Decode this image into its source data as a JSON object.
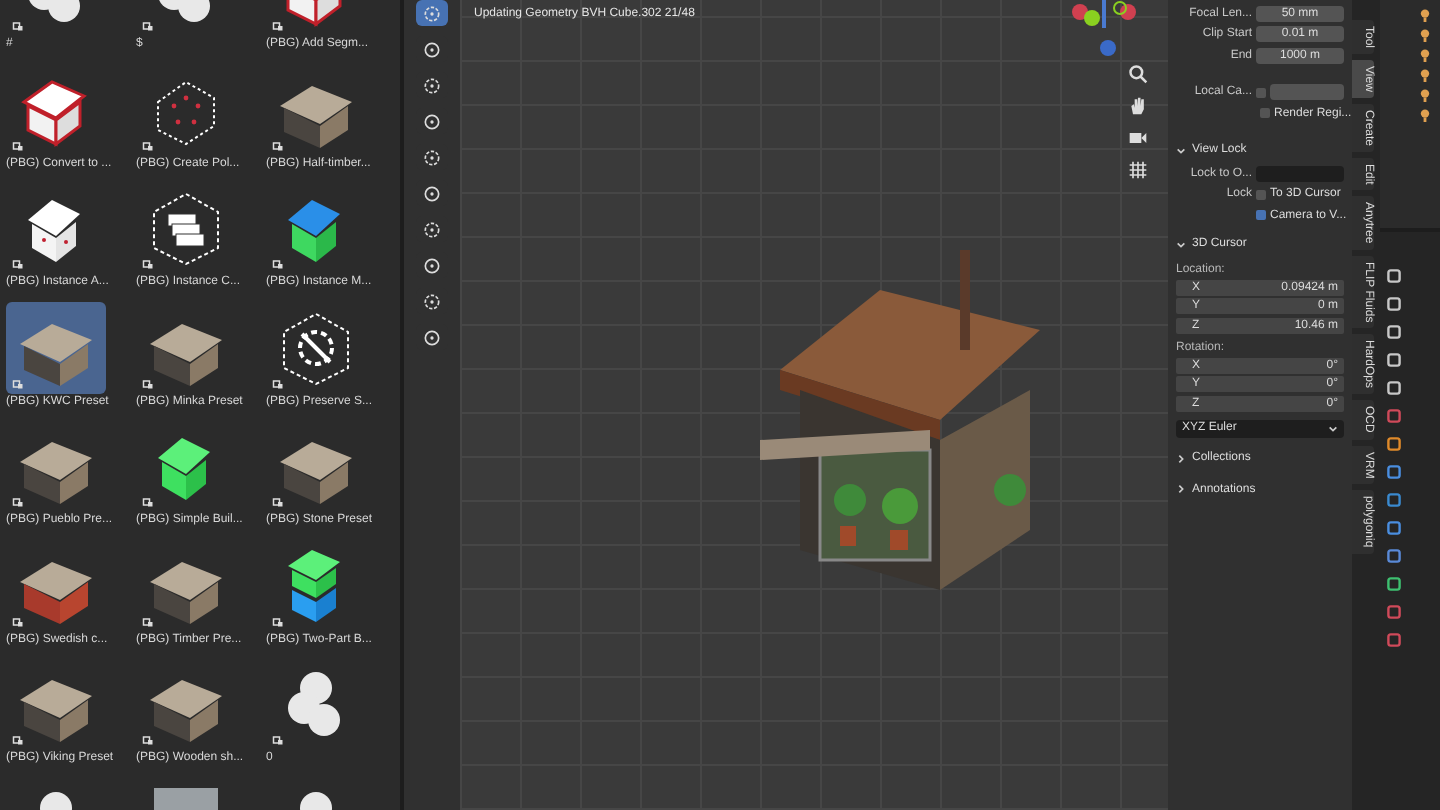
{
  "assets": [
    {
      "label": "#",
      "kind": "fluffy",
      "selected": false
    },
    {
      "label": "$",
      "kind": "fluffy",
      "selected": false
    },
    {
      "label": "(PBG) Add Segm...",
      "kind": "outline-house",
      "selected": false
    },
    {
      "label": "(PBG) Convert to ...",
      "kind": "outline-house",
      "selected": false
    },
    {
      "label": "(PBG) Create Pol...",
      "kind": "dotted-house",
      "selected": false
    },
    {
      "label": "(PBG) Half-timber...",
      "kind": "cabin",
      "selected": false
    },
    {
      "label": "(PBG) Instance A...",
      "kind": "white-house",
      "selected": false
    },
    {
      "label": "(PBG) Instance C...",
      "kind": "boxes",
      "selected": false
    },
    {
      "label": "(PBG) Instance M...",
      "kind": "blue-green-house",
      "selected": false
    },
    {
      "label": "(PBG) KWC Preset",
      "kind": "cabin",
      "selected": true
    },
    {
      "label": "(PBG) Minka Preset",
      "kind": "cabin",
      "selected": false
    },
    {
      "label": "(PBG) Preserve S...",
      "kind": "gear",
      "selected": false
    },
    {
      "label": "(PBG) Pueblo Pre...",
      "kind": "cabin",
      "selected": false
    },
    {
      "label": "(PBG) Simple Buil...",
      "kind": "green-house",
      "selected": false
    },
    {
      "label": "(PBG) Stone Preset",
      "kind": "cabin",
      "selected": false
    },
    {
      "label": "(PBG) Swedish c...",
      "kind": "red-cabin",
      "selected": false
    },
    {
      "label": "(PBG) Timber Pre...",
      "kind": "cabin",
      "selected": false
    },
    {
      "label": "(PBG) Two-Part B...",
      "kind": "stacked-house",
      "selected": false
    },
    {
      "label": "(PBG) Viking Preset",
      "kind": "cabin",
      "selected": false
    },
    {
      "label": "(PBG) Wooden sh...",
      "kind": "cabin",
      "selected": false
    },
    {
      "label": "0",
      "kind": "fluffy",
      "selected": false
    },
    {
      "kind": "fluffy",
      "selected": false
    },
    {
      "kind": "photo",
      "selected": false
    },
    {
      "kind": "fluffy",
      "selected": false
    }
  ],
  "tools": [
    {
      "selected": true
    },
    {
      "selected": false
    },
    {
      "selected": false
    },
    {
      "selected": false
    },
    {
      "selected": false
    },
    {
      "selected": false
    },
    {
      "selected": false
    },
    {
      "selected": false
    },
    {
      "selected": false
    },
    {
      "selected": false
    }
  ],
  "viewport": {
    "status": "Updating Geometry BVH Cube.302 21/48"
  },
  "sidebar": {
    "camera_fields": [
      {
        "label": "Focal Len...",
        "value": "50 mm"
      },
      {
        "label": "Clip Start",
        "value": "0.01 m"
      },
      {
        "label": "End",
        "value": "1000 m"
      }
    ],
    "local_camera": {
      "label": "Local Ca...",
      "checked": false
    },
    "render_region": {
      "label": "Render Regi...",
      "checked": false
    },
    "view_lock": {
      "title": "View Lock",
      "expanded": true,
      "lock_to_label": "Lock to O...",
      "lock_label": "Lock",
      "options": [
        {
          "label": "To 3D Cursor",
          "checked": false
        },
        {
          "label": "Camera to V...",
          "checked": true
        }
      ]
    },
    "cursor": {
      "title": "3D Cursor",
      "expanded": true,
      "location_label": "Location:",
      "location": [
        {
          "axis": "X",
          "value": "0.09424 m"
        },
        {
          "axis": "Y",
          "value": "0 m"
        },
        {
          "axis": "Z",
          "value": "10.46 m"
        }
      ],
      "rotation_label": "Rotation:",
      "rotation": [
        {
          "axis": "X",
          "value": "0°"
        },
        {
          "axis": "Y",
          "value": "0°"
        },
        {
          "axis": "Z",
          "value": "0°"
        }
      ],
      "mode": "XYZ Euler"
    },
    "sections": [
      {
        "title": "Collections",
        "expanded": false
      },
      {
        "title": "Annotations",
        "expanded": false
      }
    ]
  },
  "tabs": [
    {
      "label": "Tool",
      "selected": false
    },
    {
      "label": "View",
      "selected": true
    },
    {
      "label": "Create",
      "selected": false
    },
    {
      "label": "Edit",
      "selected": false
    },
    {
      "label": "Anytree",
      "selected": false
    },
    {
      "label": "FLIP Fluids",
      "selected": false
    },
    {
      "label": "HardOps",
      "selected": false
    },
    {
      "label": "OCD",
      "selected": false
    },
    {
      "label": "VRM",
      "selected": false
    },
    {
      "label": "polygoniq",
      "selected": false
    }
  ]
}
